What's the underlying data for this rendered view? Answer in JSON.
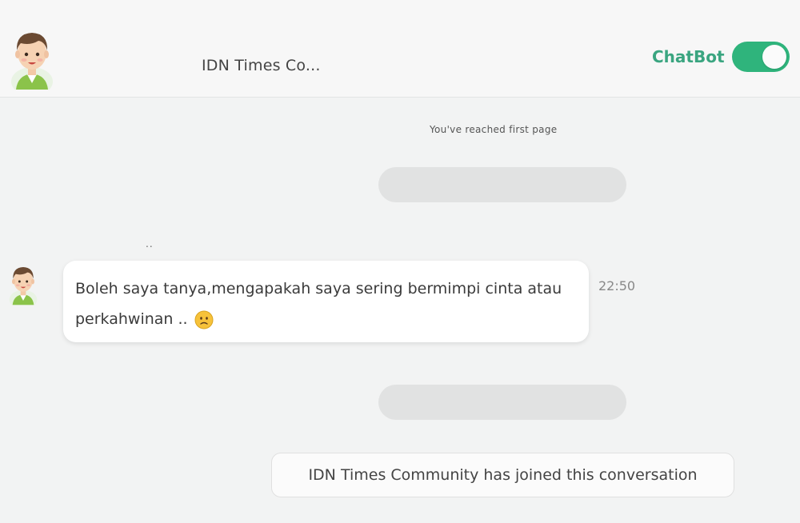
{
  "header": {
    "title": "IDN Times Co...",
    "chatbot_label": "ChatBot",
    "chatbot_enabled": true,
    "avatar_icon": "man-avatar-icon"
  },
  "conversation": {
    "first_page_notice": "You've reached first page",
    "typing_indicator": "..",
    "messages": [
      {
        "sender_avatar": "man-avatar-icon",
        "text": "Boleh saya tanya,mengapakah saya sering bermimpi cinta atau perkahwinan ..",
        "emoji": "worried-face-emoji",
        "time": "22:50"
      }
    ],
    "system_message": "IDN Times Community has joined this conversation"
  },
  "colors": {
    "accent": "#2fb47c",
    "chatbot_label": "#3aa580",
    "background": "#f2f3f3",
    "placeholder_pill": "#e1e2e2"
  }
}
